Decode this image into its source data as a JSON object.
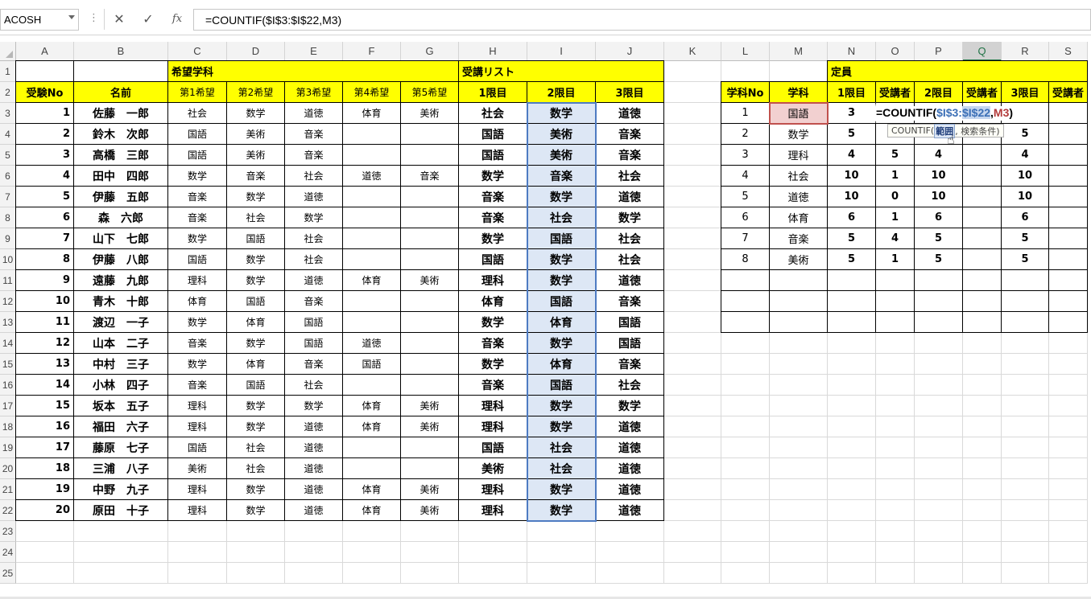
{
  "formula_bar": {
    "name_box": "ACOSH",
    "cancel_glyph": "✕",
    "enter_glyph": "✓",
    "fx_glyph": "fx",
    "formula": "=COUNTIF($I$3:$I$22,M3)"
  },
  "columns": [
    "A",
    "B",
    "C",
    "D",
    "E",
    "F",
    "G",
    "H",
    "I",
    "J",
    "K",
    "L",
    "M",
    "N",
    "O",
    "P",
    "Q",
    "R",
    "S"
  ],
  "selected_column": "Q",
  "rows": [
    "1",
    "2",
    "3",
    "4",
    "5",
    "6",
    "7",
    "8",
    "9",
    "10",
    "11",
    "12",
    "13",
    "14",
    "15",
    "16",
    "17",
    "18",
    "19",
    "20",
    "21",
    "22",
    "23",
    "24",
    "25"
  ],
  "colors": {
    "header_yellow": "#ffff00",
    "range_highlight": "#dde7f5",
    "active_cell": "#f2d0d0",
    "selection_green": "#217346"
  },
  "table1": {
    "group_headers": {
      "choice": "希望学科",
      "list": "受講リスト"
    },
    "headers": [
      "受験No",
      "名前",
      "第1希望",
      "第2希望",
      "第3希望",
      "第4希望",
      "第5希望",
      "1限目",
      "2限目",
      "3限目"
    ],
    "rows": [
      [
        "1",
        "佐藤　一郎",
        "社会",
        "数学",
        "道徳",
        "体育",
        "美術",
        "社会",
        "数学",
        "道徳"
      ],
      [
        "2",
        "鈴木　次郎",
        "国語",
        "美術",
        "音楽",
        "",
        "",
        "国語",
        "美術",
        "音楽"
      ],
      [
        "3",
        "高橋　三郎",
        "国語",
        "美術",
        "音楽",
        "",
        "",
        "国語",
        "美術",
        "音楽"
      ],
      [
        "4",
        "田中　四郎",
        "数学",
        "音楽",
        "社会",
        "道徳",
        "音楽",
        "数学",
        "音楽",
        "社会"
      ],
      [
        "5",
        "伊藤　五郎",
        "音楽",
        "数学",
        "道徳",
        "",
        "",
        "音楽",
        "数学",
        "道徳"
      ],
      [
        "6",
        "森　六郎",
        "音楽",
        "社会",
        "数学",
        "",
        "",
        "音楽",
        "社会",
        "数学"
      ],
      [
        "7",
        "山下　七郎",
        "数学",
        "国語",
        "社会",
        "",
        "",
        "数学",
        "国語",
        "社会"
      ],
      [
        "8",
        "伊藤　八郎",
        "国語",
        "数学",
        "社会",
        "",
        "",
        "国語",
        "数学",
        "社会"
      ],
      [
        "9",
        "遠藤　九郎",
        "理科",
        "数学",
        "道徳",
        "体育",
        "美術",
        "理科",
        "数学",
        "道徳"
      ],
      [
        "10",
        "青木　十郎",
        "体育",
        "国語",
        "音楽",
        "",
        "",
        "体育",
        "国語",
        "音楽"
      ],
      [
        "11",
        "渡辺　一子",
        "数学",
        "体育",
        "国語",
        "",
        "",
        "数学",
        "体育",
        "国語"
      ],
      [
        "12",
        "山本　二子",
        "音楽",
        "数学",
        "国語",
        "道徳",
        "",
        "音楽",
        "数学",
        "国語"
      ],
      [
        "13",
        "中村　三子",
        "数学",
        "体育",
        "音楽",
        "国語",
        "",
        "数学",
        "体育",
        "音楽"
      ],
      [
        "14",
        "小林　四子",
        "音楽",
        "国語",
        "社会",
        "",
        "",
        "音楽",
        "国語",
        "社会"
      ],
      [
        "15",
        "坂本　五子",
        "理科",
        "数学",
        "数学",
        "体育",
        "美術",
        "理科",
        "数学",
        "数学"
      ],
      [
        "16",
        "福田　六子",
        "理科",
        "数学",
        "道徳",
        "体育",
        "美術",
        "理科",
        "数学",
        "道徳"
      ],
      [
        "17",
        "藤原　七子",
        "国語",
        "社会",
        "道徳",
        "",
        "",
        "国語",
        "社会",
        "道徳"
      ],
      [
        "18",
        "三浦　八子",
        "美術",
        "社会",
        "道徳",
        "",
        "",
        "美術",
        "社会",
        "道徳"
      ],
      [
        "19",
        "中野　九子",
        "理科",
        "数学",
        "道徳",
        "体育",
        "美術",
        "理科",
        "数学",
        "道徳"
      ],
      [
        "20",
        "原田　十子",
        "理科",
        "数学",
        "道徳",
        "体育",
        "美術",
        "理科",
        "数学",
        "道徳"
      ]
    ]
  },
  "table2": {
    "group_header": "定員",
    "headers": [
      "学科No",
      "学科",
      "1限目",
      "受講者",
      "2限目",
      "受講者",
      "3限目",
      "受講者"
    ],
    "rows": [
      [
        "1",
        "国語",
        "3",
        "",
        "",
        "",
        "",
        ""
      ],
      [
        "2",
        "数学",
        "5",
        "",
        "",
        "",
        "5",
        ""
      ],
      [
        "3",
        "理科",
        "4",
        "5",
        "4",
        "",
        "4",
        ""
      ],
      [
        "4",
        "社会",
        "10",
        "1",
        "10",
        "",
        "10",
        ""
      ],
      [
        "5",
        "道徳",
        "10",
        "0",
        "10",
        "",
        "10",
        ""
      ],
      [
        "6",
        "体育",
        "6",
        "1",
        "6",
        "",
        "6",
        ""
      ],
      [
        "7",
        "音楽",
        "5",
        "4",
        "5",
        "",
        "5",
        ""
      ],
      [
        "8",
        "美術",
        "5",
        "1",
        "5",
        "",
        "5",
        ""
      ]
    ],
    "editing_formula": {
      "prefix": "=COUNTIF(",
      "range_start": "$I$3:",
      "range_end": "$I$22",
      "sep": ",",
      "criteria": "M3",
      "close": ")"
    }
  },
  "tooltip": {
    "func": "COUNTIF(",
    "arg1": "範囲",
    "rest": ", 検索条件)"
  }
}
